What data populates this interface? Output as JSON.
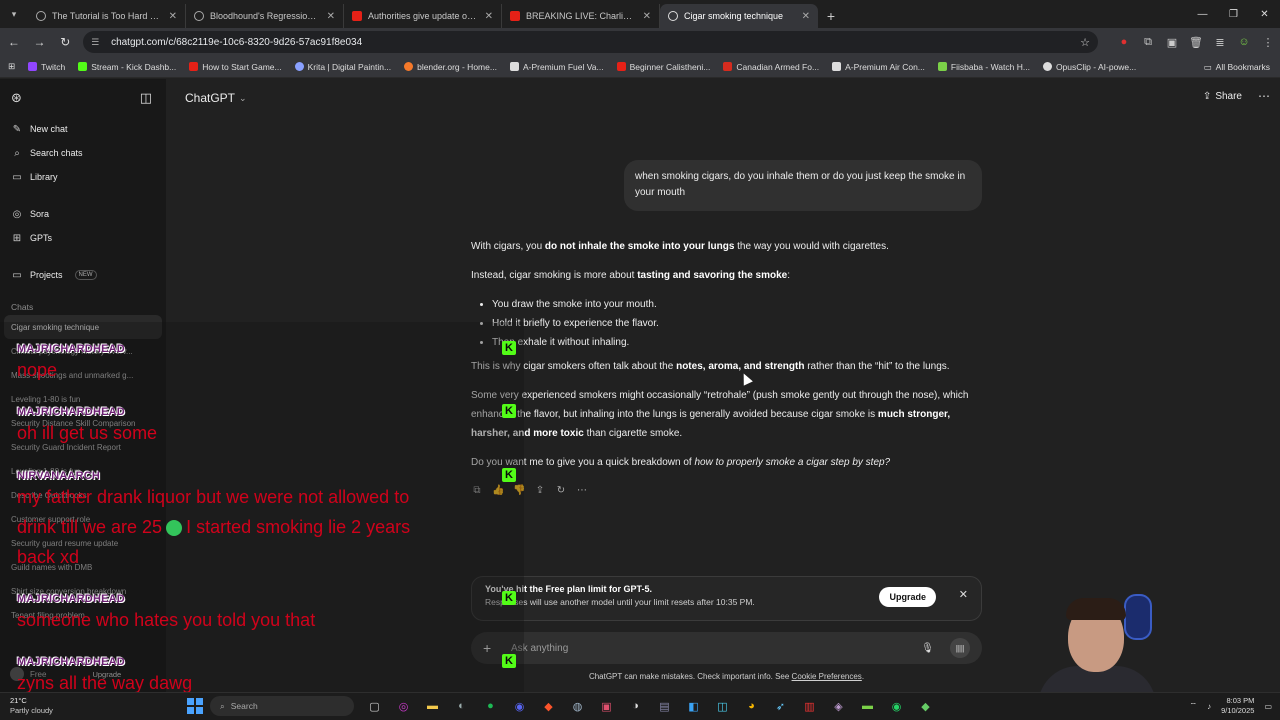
{
  "browser": {
    "tabs": [
      {
        "title": "The Tutorial is Too Hard Chapter",
        "icon": "globe",
        "active": false
      },
      {
        "title": "Bloodhound's Regression Instinct",
        "icon": "globe",
        "active": false
      },
      {
        "title": "Authorities give update on Cha",
        "icon": "yt",
        "active": false
      },
      {
        "title": "BREAKING LIVE: Charlie Kirk de",
        "icon": "yt",
        "active": false
      },
      {
        "title": "Cigar smoking technique",
        "icon": "gpt",
        "active": true
      }
    ],
    "url": "chatgpt.com/c/68c2119e-10c6-8320-9d26-57ac91f8e034",
    "bookmarks": [
      {
        "label": "Twitch",
        "color": "#9146ff"
      },
      {
        "label": "Stream - Kick Dashb...",
        "color": "#53fc18"
      },
      {
        "label": "How to Start Game...",
        "color": "#e62117"
      },
      {
        "label": "Krita | Digital Paintin...",
        "color": "#8aa1ff"
      },
      {
        "label": "blender.org - Home...",
        "color": "#f5792a"
      },
      {
        "label": "A-Premium Fuel Va...",
        "color": "#dddddd"
      },
      {
        "label": "Beginner Calistheni...",
        "color": "#e62117"
      },
      {
        "label": "Canadian Armed Fo...",
        "color": "#d52b1e"
      },
      {
        "label": "A-Premium Air Con...",
        "color": "#dddddd"
      },
      {
        "label": "Fiisbaba - Watch H...",
        "color": "#7bd148"
      },
      {
        "label": "OpusClip - AI-powe...",
        "color": "#dddddd"
      }
    ],
    "all_bookmarks": "All Bookmarks"
  },
  "sidebar": {
    "primary": [
      {
        "label": "New chat",
        "icon": "✎",
        "name": "new-chat"
      },
      {
        "label": "Search chats",
        "icon": "⌕",
        "name": "search-chats"
      },
      {
        "label": "Library",
        "icon": "▭",
        "name": "library"
      }
    ],
    "secondary": [
      {
        "label": "Sora",
        "icon": "◎",
        "name": "sora"
      },
      {
        "label": "GPTs",
        "icon": "⊞",
        "name": "gpts"
      }
    ],
    "projects_label": "Projects",
    "new_badge": "NEW",
    "chats_heading": "Chats",
    "chats": [
      "Cigar smoking technique",
      "Clinical psychology history overv...",
      "Mass shootings and unmarked g...",
      "Leveling 1-80 is fun",
      "Security Distance Skill Comparison",
      "Security Guard Incident Report",
      "Leveling 1-80 is fun",
      "Describe Quickbooks",
      "Customer support role",
      "Security guard resume update",
      "Guild names with DMB",
      "Shirt size conversion breakdown",
      "Tenant filing problem"
    ],
    "user_plan": "Free",
    "upgrade": "Upgrade"
  },
  "main": {
    "model": "ChatGPT",
    "share": "Share",
    "user_message": "when smoking cigars, do you inhale them or do you just keep the smoke in your mouth",
    "reply": {
      "p1_pre": "With cigars, you ",
      "p1_bold": "do not inhale the smoke into your lungs",
      "p1_post": " the way you would with cigarettes.",
      "p2_pre": "Instead, cigar smoking is more about ",
      "p2_bold": "tasting and savoring the smoke",
      "p2_post": ":",
      "bullets": [
        "You draw the smoke into your mouth.",
        "Hold it briefly to experience the flavor.",
        "Then exhale it without inhaling."
      ],
      "p3_pre": "This is why cigar smokers often talk about the ",
      "p3_bold": "notes, aroma, and strength",
      "p3_post": " rather than the “hit” to the lungs.",
      "p4_pre": "Some very experienced smokers might occasionally “retrohale” (push smoke gently out through the nose), which enhances the flavor, but inhaling into the lungs is generally avoided because cigar smoke is ",
      "p4_bold": "much stronger, harsher, and more toxic",
      "p4_post": " than cigarette smoke.",
      "p5_pre": "Do you want me to give you a quick breakdown of ",
      "p5_italic": "how to properly smoke a cigar step by step?",
      "p5_post": ""
    },
    "limit_banner": {
      "title": "You've hit the Free plan limit for GPT-5.",
      "subtitle": "Responses will use another model until your limit resets after 10:35 PM.",
      "button": "Upgrade"
    },
    "composer_placeholder": "Ask anything",
    "disclaimer_pre": "ChatGPT can make mistakes. Check important info. See ",
    "disclaimer_link": "Cookie Preferences",
    "disclaimer_post": "."
  },
  "taskbar": {
    "weather_temp": "21°C",
    "weather_desc": "Partly cloudy",
    "search": "Search",
    "time": "8:03 PM",
    "date": "9/10/2025"
  },
  "stream_chat": [
    {
      "user": "MAJRICHARDHEAD",
      "text": "nope"
    },
    {
      "user": "MAJRICHARDHEAD",
      "text": "oh ill get us some"
    },
    {
      "user": "NIRVANAARCH",
      "text": "my father drank liquor but we were not allowed to",
      "text2a": "drink till we are 25",
      "text2b": "I started smoking lie 2 years",
      "text3": "back xd"
    },
    {
      "user": "MAJRICHARDHEAD",
      "text": "someone who hates you told you that"
    },
    {
      "user": "MAJRICHARDHEAD",
      "text": "zyns all the way dawg"
    }
  ],
  "kick_glyph": "K"
}
